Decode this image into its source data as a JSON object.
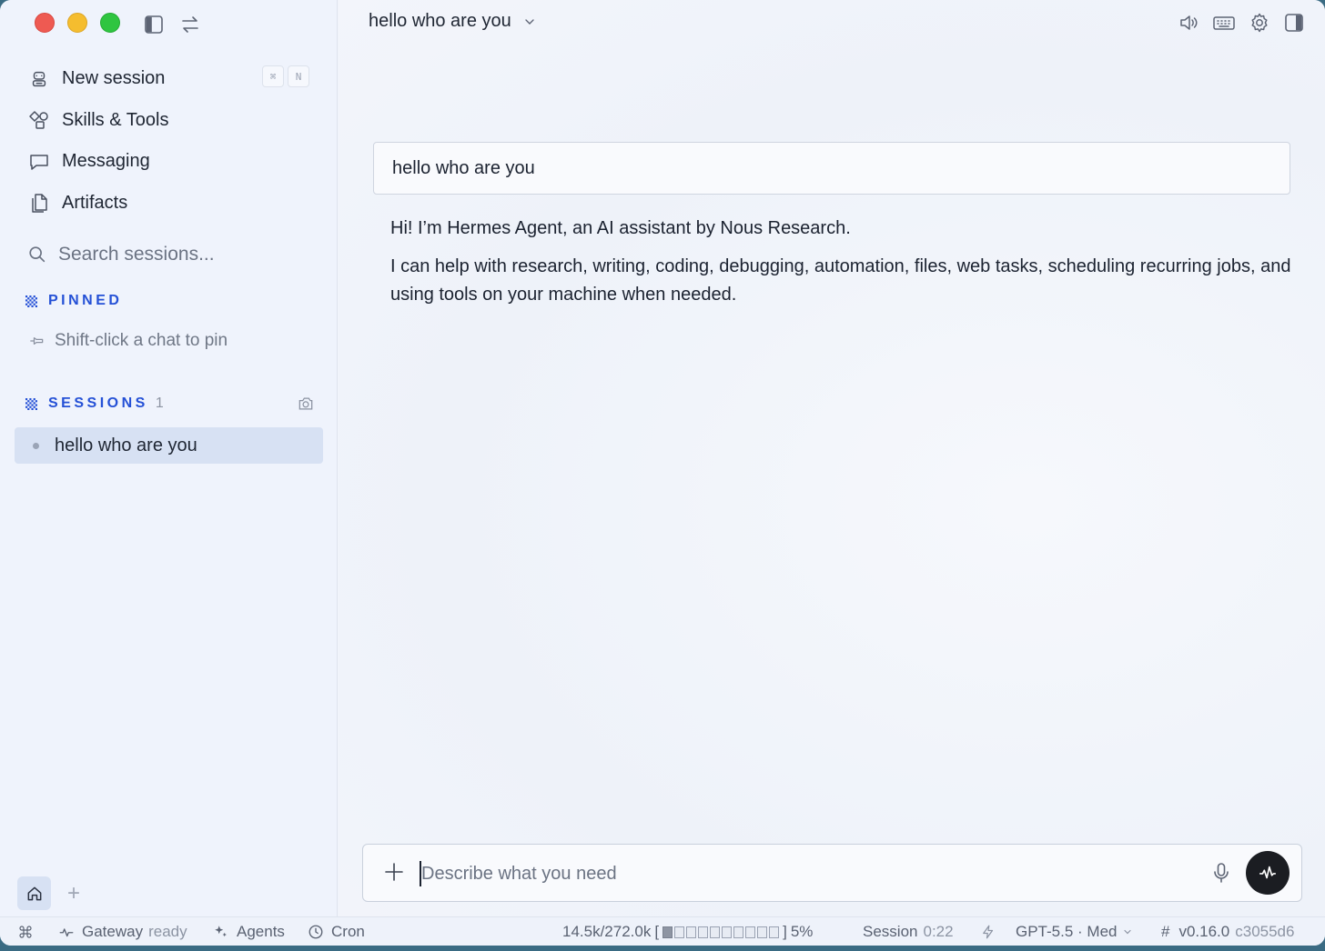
{
  "sidebar": {
    "nav": [
      {
        "label": "New session",
        "shortcut": [
          "⌘",
          "N"
        ]
      },
      {
        "label": "Skills & Tools"
      },
      {
        "label": "Messaging"
      },
      {
        "label": "Artifacts"
      }
    ],
    "search_placeholder": "Search sessions...",
    "pinned": {
      "title": "PINNED",
      "hint": "Shift-click a chat to pin"
    },
    "sessions": {
      "title": "SESSIONS",
      "count": "1",
      "items": [
        "hello who are you"
      ]
    }
  },
  "header": {
    "title": "hello who are you"
  },
  "conversation": {
    "user_message": "hello who are you",
    "assistant_paragraphs": [
      "Hi! I’m Hermes Agent, an AI assistant by Nous Research.",
      "I can help with research, writing, coding, debugging, automation, files, web tasks, scheduling recurring jobs, and using tools on your machine when needed."
    ]
  },
  "composer": {
    "placeholder": "Describe what you need"
  },
  "statusbar": {
    "gateway_label": "Gateway",
    "gateway_status": "ready",
    "agents": "Agents",
    "cron": "Cron",
    "tokens": "14.5k/272.0k",
    "context_percent": "5%",
    "context_fraction": 0.05,
    "session_label": "Session",
    "session_time": "0:22",
    "model": "GPT-5.5 · Med",
    "version": "v0.16.0",
    "commit": "c3055d6"
  },
  "colors": {
    "accent": "#2450d6",
    "selected_row": "#d7e1f3",
    "send_button": "#1b1d22"
  }
}
